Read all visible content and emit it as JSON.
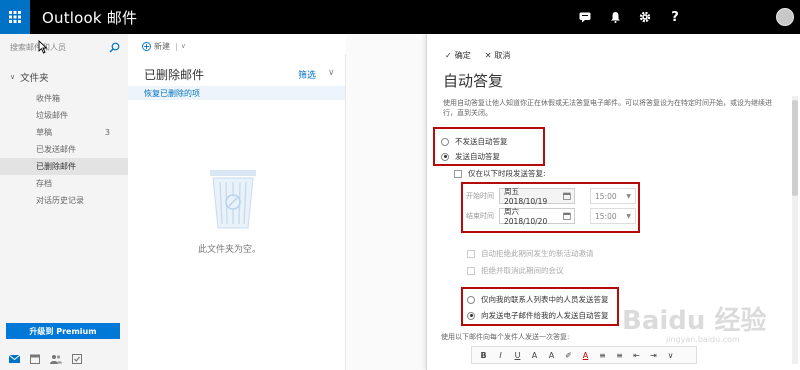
{
  "app": {
    "title": "Outlook 邮件"
  },
  "topbar": {
    "icons": [
      "chat-icon",
      "bell-icon",
      "gear-icon",
      "help-icon"
    ],
    "help_label": "?"
  },
  "leftpane": {
    "search_placeholder": "搜索邮件和人员",
    "folders_title": "文件夹",
    "folders": [
      {
        "label": "收件箱",
        "count": ""
      },
      {
        "label": "垃圾邮件",
        "count": ""
      },
      {
        "label": "草稿",
        "count": "3"
      },
      {
        "label": "已发送邮件",
        "count": ""
      },
      {
        "label": "已删除邮件",
        "count": "",
        "active": true
      },
      {
        "label": "存档",
        "count": ""
      },
      {
        "label": "对话历史记录",
        "count": ""
      }
    ],
    "premium_label": "升级到 Premium"
  },
  "commandbar": {
    "new_label": "新建"
  },
  "msglist": {
    "title": "已删除邮件",
    "filter_label": "筛选",
    "recover_label": "恢复已删除的项",
    "empty_text": "此文件夹为空。"
  },
  "panel": {
    "ok_label": "确定",
    "cancel_label": "取消",
    "title": "自动答复",
    "description": "使用自动答复让他人知道你正在休假或无法答复电子邮件。可以将答复设为在特定时间开始，或设为继续进行，直到关闭。",
    "radio_off": "不发送自动答复",
    "radio_on": "发送自动答复",
    "period_check": "仅在以下时段发送答复:",
    "start_label": "开始时间",
    "start_date": "周五 2018/10/19",
    "start_time": "15:00",
    "end_label": "结束时间",
    "end_date": "周六 2018/10/20",
    "end_time": "15:00",
    "opt_decline": "自动拒绝此期间发生的新活动邀请",
    "opt_cancel": "拒绝并取消此期间的会议",
    "contacts_only": "仅向我的联系人列表中的人员发送答复",
    "all_senders": "向发送电子邮件给我的人发送自动答复",
    "once_label": "使用以下邮件向每个发件人发送一次答复:"
  },
  "watermark": {
    "text": "Baidu 经验",
    "sub": "jingyan.baidu.com"
  },
  "colors": {
    "accent": "#0072c6",
    "highlight": "#b50b0b",
    "topbar": "#000000"
  }
}
